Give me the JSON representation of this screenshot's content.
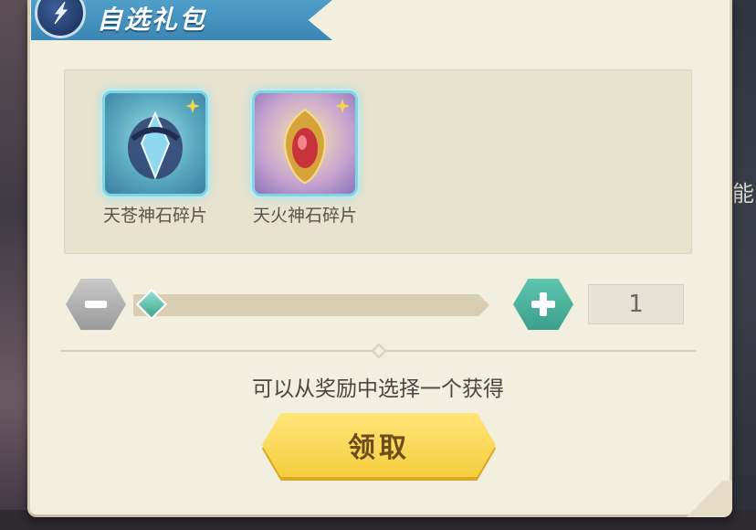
{
  "dialog": {
    "title": "自选礼包",
    "hint": "可以从奖励中选择一个获得",
    "claim_label": "领取"
  },
  "rewards": [
    {
      "name": "天苍神石碎片",
      "icon": "blue-divine-stone-icon"
    },
    {
      "name": "天火神石碎片",
      "icon": "fire-divine-stone-icon"
    }
  ],
  "quantity": {
    "value": "1",
    "minus_icon": "minus-icon",
    "plus_icon": "plus-icon",
    "slider_fraction": 0
  },
  "background": {
    "right_edge_text": "能"
  },
  "colors": {
    "ribbon": "#3b86b4",
    "plus_button": "#3a9f8b",
    "minus_button": "#9a9a9a",
    "claim_button": "#f6cd3e",
    "panel": "#f3efdf"
  }
}
